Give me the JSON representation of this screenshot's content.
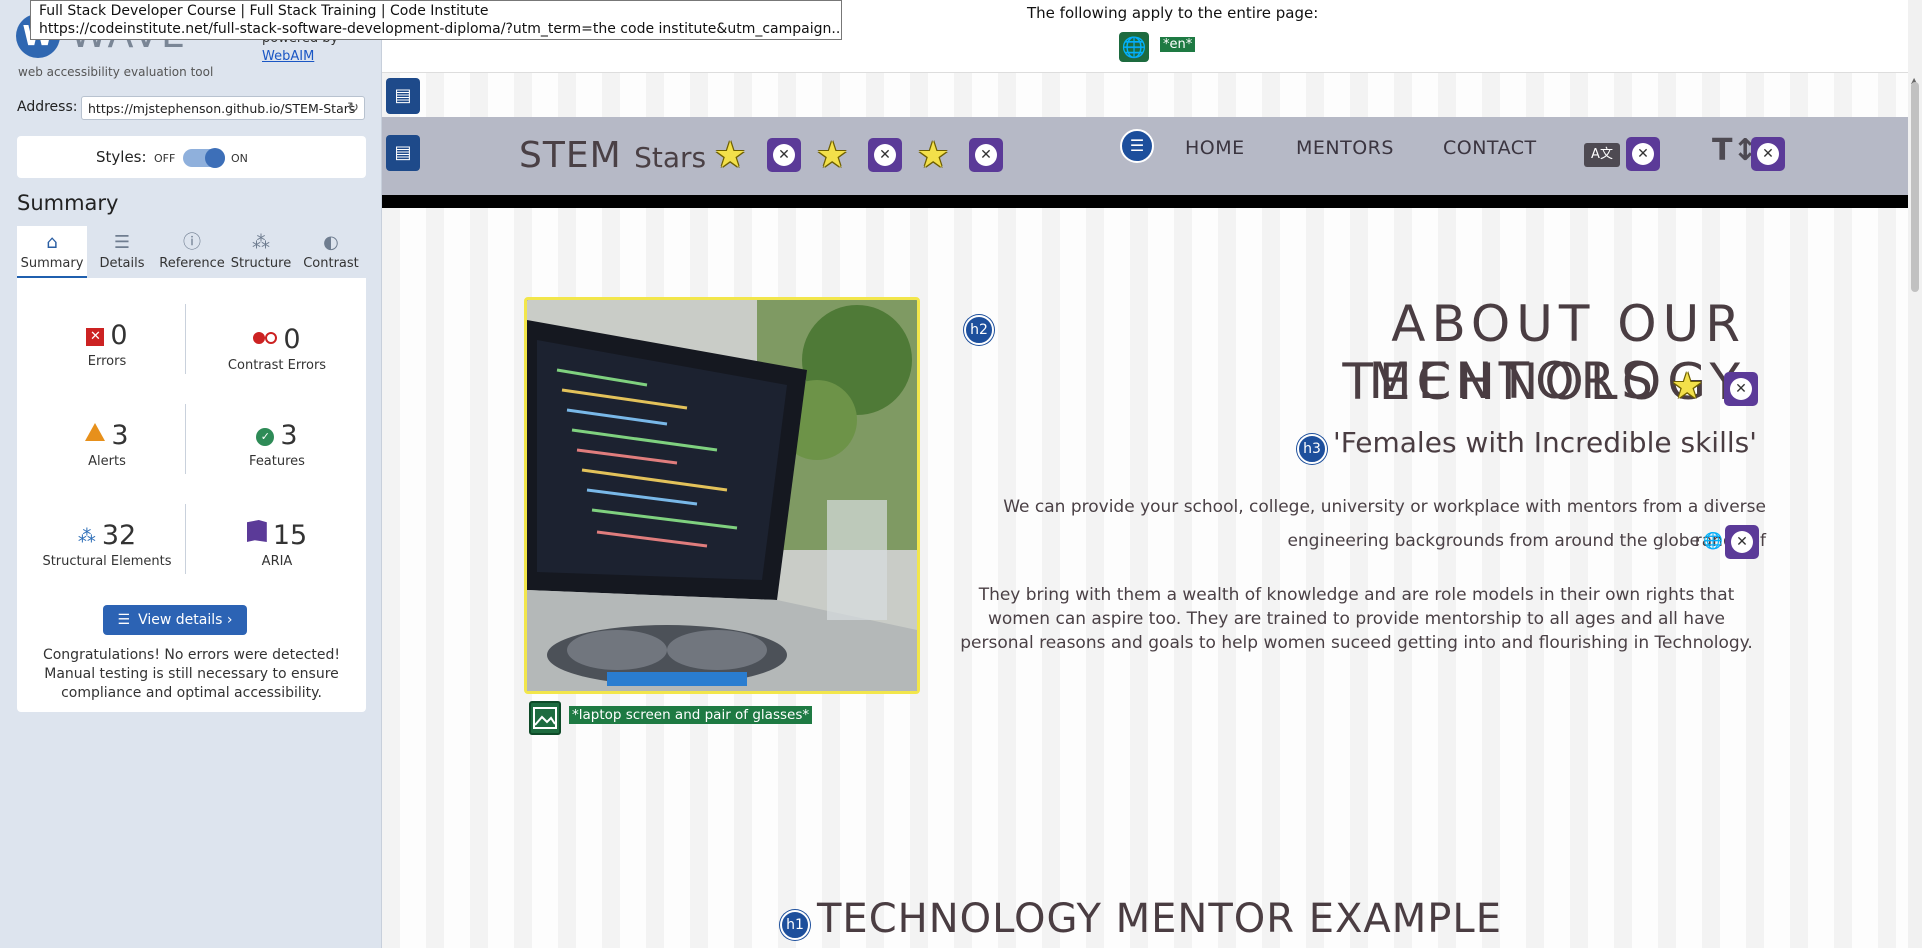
{
  "tooltip": {
    "line1": "Full Stack Developer Course | Full Stack Training | Code Institute",
    "line2": "https://codeinstitute.net/full-stack-software-development-diploma/?utm_term=the code institute&utm_campaign..."
  },
  "wave": {
    "logo_letter": "W",
    "logo_word": "WAVE",
    "tagline": "web accessibility evaluation tool",
    "powered_by": "powered by",
    "webaim": "WebAIM",
    "address_label": "Address:",
    "address_value": "https://mjstephenson.github.io/STEM-Stars",
    "styles_label": "Styles:",
    "off_label": "OFF",
    "on_label": "ON",
    "summary_heading": "Summary",
    "tabs": [
      {
        "label": "Summary",
        "icon": "home-icon",
        "glyph": "⌂"
      },
      {
        "label": "Details",
        "icon": "list-icon",
        "glyph": "☰"
      },
      {
        "label": "Reference",
        "icon": "info-icon",
        "glyph": "ⓘ"
      },
      {
        "label": "Structure",
        "icon": "structure-icon",
        "glyph": "⁂"
      },
      {
        "label": "Contrast",
        "icon": "contrast-icon",
        "glyph": "◐"
      }
    ],
    "stats": {
      "errors": {
        "value": "0",
        "label": "Errors"
      },
      "contrast_errors": {
        "value": "0",
        "label": "Contrast Errors"
      },
      "alerts": {
        "value": "3",
        "label": "Alerts"
      },
      "features": {
        "value": "3",
        "label": "Features"
      },
      "structural": {
        "value": "32",
        "label": "Structural Elements"
      },
      "aria": {
        "value": "15",
        "label": "ARIA"
      }
    },
    "view_details": "View details ›",
    "congrats": "Congratulations! No errors were detected! Manual testing is still necessary to ensure compliance and optimal accessibility."
  },
  "page": {
    "apply_text": "The following apply to the entire page:",
    "lang_tag": "*en*",
    "brand_main": "STEM",
    "brand_sub": "Stars",
    "nav_links": [
      "HOME",
      "MENTORS",
      "CONTACT"
    ],
    "lang_icon_glyph": "A文",
    "textsize_glyph": "T↕",
    "heading_about_line1": "ABOUT OUR TECHNOLOGY",
    "heading_about_line2": "MENTORS",
    "h2_badge": "h2",
    "h3_badge": "h3",
    "h1_badge": "h1",
    "subheading": "'Females with Incredible skills'",
    "para1_line1": "We can provide your school, college, university or workplace with mentors from a diverse range of",
    "para1_line2": "engineering backgrounds from around the globe",
    "para2": "They bring with them a wealth of knowledge and are role models in their own rights that women can aspire too. They are trained to provide mentorship to all ages and all have personal reasons and goals to help women suceed getting into and flourishing in Technology.",
    "img_alt_tag": "*laptop screen and pair of glasses*",
    "heading_example": "TECHNOLOGY MENTOR EXAMPLE"
  },
  "colors": {
    "wave_blue": "#2c63b4",
    "aria_purple": "#5b3a98",
    "feature_green": "#1e7a43",
    "nav_gray": "#b6b9c6"
  }
}
